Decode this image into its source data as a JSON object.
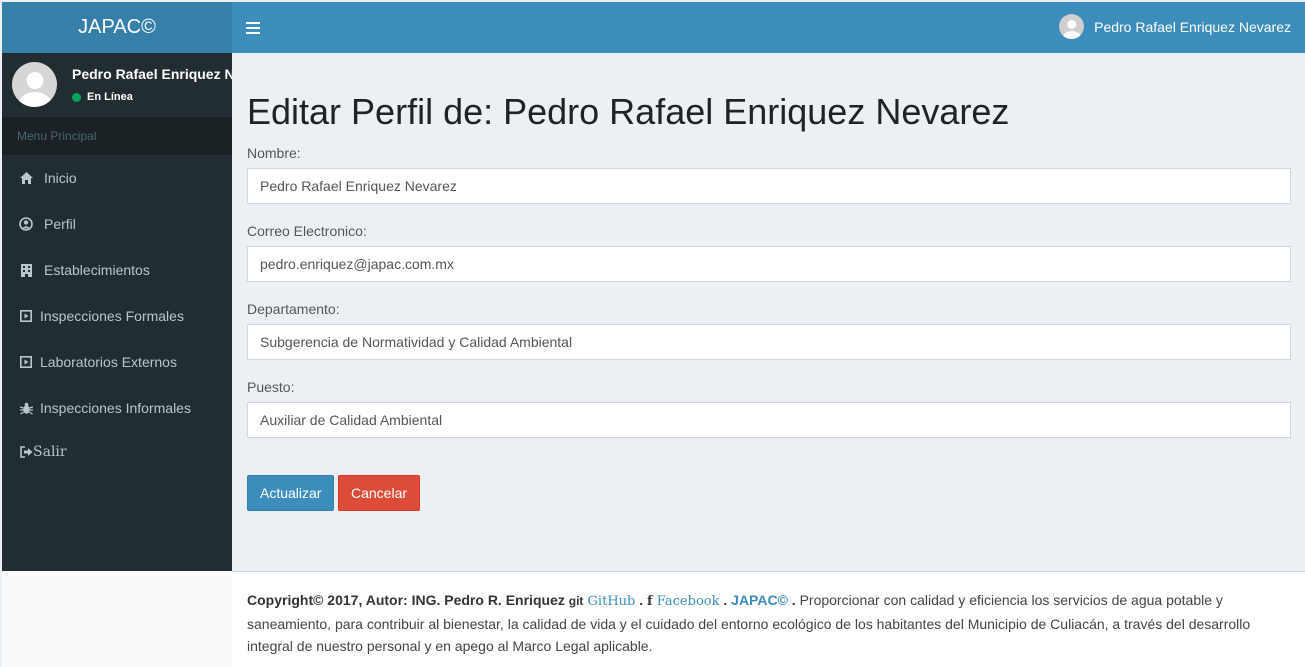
{
  "header": {
    "logo": "JAPAC©",
    "user_name": "Pedro Rafael Enriquez Nevarez"
  },
  "sidebar": {
    "user_name": "Pedro Rafael Enriquez Nevarez",
    "status": "En Línea",
    "menu_header": "Menu Principal",
    "items": [
      {
        "label": "Inicio",
        "icon": "home-icon"
      },
      {
        "label": "Perfil",
        "icon": "user-circle-icon"
      },
      {
        "label": "Establecimientos",
        "icon": "building-icon"
      },
      {
        "label": "Inspecciones Formales",
        "icon": "play-square-icon"
      },
      {
        "label": "Laboratorios Externos",
        "icon": "play-square-icon"
      },
      {
        "label": "Inspecciones Informales",
        "icon": "bug-icon"
      },
      {
        "label": "Salir",
        "icon": "sign-out-icon"
      }
    ]
  },
  "form": {
    "title": "Editar Perfil de: Pedro Rafael Enriquez Nevarez",
    "nombre_label": "Nombre:",
    "nombre_value": "Pedro Rafael Enriquez Nevarez",
    "correo_label": "Correo Electronico:",
    "correo_value": "pedro.enriquez@japac.com.mx",
    "departamento_label": "Departamento:",
    "departamento_value": "Subgerencia de Normatividad y Calidad Ambiental",
    "puesto_label": "Puesto:",
    "puesto_value": "Auxiliar de Calidad Ambiental",
    "update_label": "Actualizar",
    "cancel_label": "Cancelar"
  },
  "footer": {
    "copyright": "Copyright© 2017, Autor: ING. Pedro R. Enriquez",
    "git_icon_text": "git",
    "github_label": "GitHub",
    "facebook_icon_text": "f",
    "facebook_label": "Facebook",
    "brand": "JAPAC©",
    "dot": ".",
    "mission": "Proporcionar con calidad y eficiencia los servicios de agua potable y saneamiento, para contribuir al bienestar, la calidad de vida y el cuidado del entorno ecológico de los habitantes del Municipio de Culiacán, a través del desarrollo integral de nuestro personal y en apego al Marco Legal aplicable."
  },
  "colors": {
    "header": "#3c8dbc",
    "logo": "#367fa9",
    "sidebar": "#222d32",
    "primary": "#3c8dbc",
    "danger": "#dd4b39",
    "online": "#00a65a"
  }
}
